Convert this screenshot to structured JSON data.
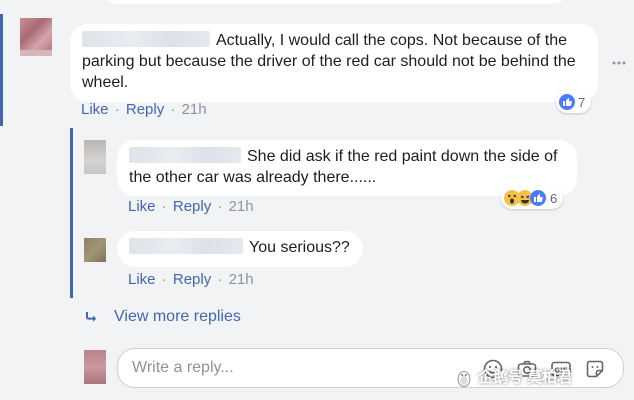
{
  "top_comment": {
    "text": "Actually, I would call the cops. Not because of the parking but because the driver of the red car should not be behind the wheel.",
    "actions": {
      "like": "Like",
      "reply": "Reply",
      "separator": "·",
      "time": "21h"
    },
    "reactions": {
      "count": "7",
      "types": [
        "like-reaction-icon"
      ]
    }
  },
  "replies": [
    {
      "text": "She did ask if the red paint down the side of the other car was already there......",
      "actions": {
        "like": "Like",
        "reply": "Reply",
        "separator": "·",
        "time": "21h"
      },
      "reactions": {
        "count": "6",
        "types": [
          "wow-reaction-icon",
          "haha-reaction-icon",
          "like-reaction-icon"
        ]
      }
    },
    {
      "text": "You serious??",
      "actions": {
        "like": "Like",
        "reply": "Reply",
        "separator": "·",
        "time": "21h"
      }
    }
  ],
  "view_more": {
    "label": "View more replies",
    "icon": "reply-arrow-icon"
  },
  "reply_box": {
    "placeholder": "Write a reply...",
    "tools": [
      "emoji-icon",
      "camera-icon",
      "gif-icon",
      "sticker-icon"
    ]
  },
  "watermark": "企鹅号 莫柏君",
  "colors": {
    "accent": "#4267b2",
    "background": "#f2f3f5",
    "bubble": "#ffffff"
  }
}
